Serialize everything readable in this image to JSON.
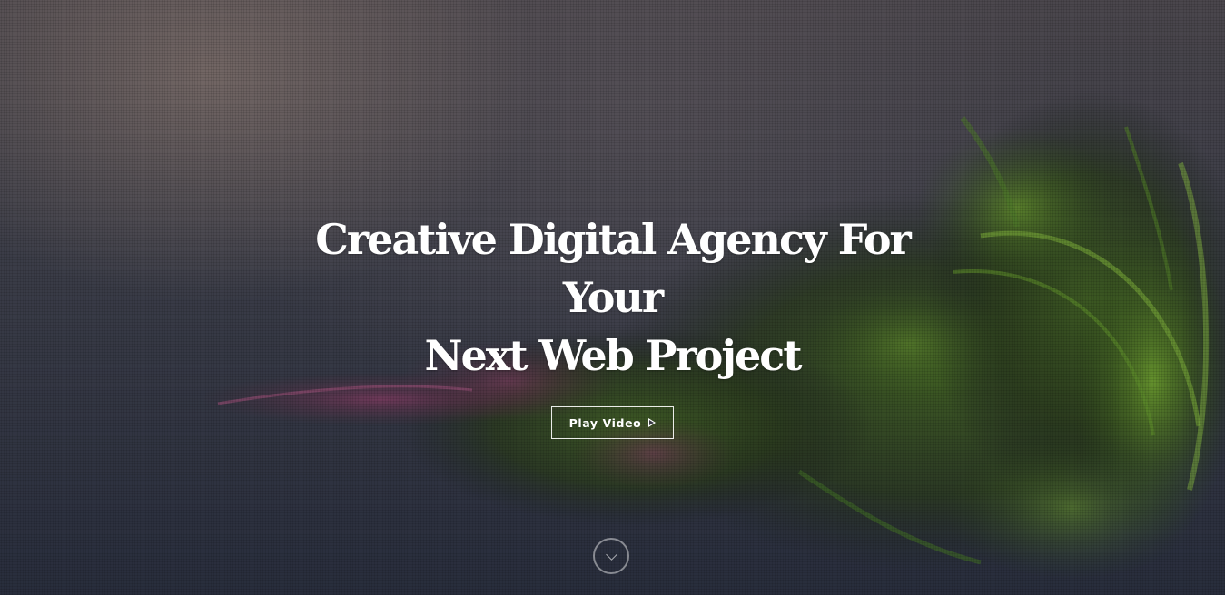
{
  "hero": {
    "title_line1": "Creative Digital Agency For Your",
    "title_line2": "Next Web Project",
    "play_button_label": "Play Video",
    "play_icon": "play-triangle-icon",
    "scroll_icon": "chevron-down-icon"
  },
  "colors": {
    "text": "#ffffff",
    "background_top": "#4a464c",
    "background_bottom": "#282d3c",
    "foliage_green": "#4f7a2a",
    "foliage_magenta": "#7a3a5a"
  }
}
